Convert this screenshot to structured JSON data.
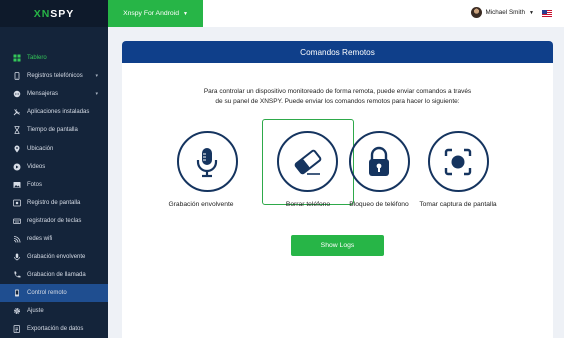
{
  "brand": {
    "prefix": "XN",
    "suffix": "SPY"
  },
  "device_selector": {
    "label": "Xnspy For Android"
  },
  "user": {
    "name": "Michael Smith"
  },
  "sidebar": {
    "items": [
      {
        "label": "Tablero",
        "icon": "dashboard-icon"
      },
      {
        "label": "Registros telefónicos",
        "icon": "phone-icon",
        "has_submenu": true
      },
      {
        "label": "Mensajeras",
        "icon": "message-icon",
        "has_submenu": true
      },
      {
        "label": "Aplicaciones instaladas",
        "icon": "apps-icon"
      },
      {
        "label": "Tiempo de pantalla",
        "icon": "hourglass-icon"
      },
      {
        "label": "Ubicación",
        "icon": "location-icon"
      },
      {
        "label": "Videos",
        "icon": "video-icon"
      },
      {
        "label": "Fotos",
        "icon": "photo-icon"
      },
      {
        "label": "Registro de pantalla",
        "icon": "screen-record-icon"
      },
      {
        "label": "registrador de teclas",
        "icon": "keyboard-icon"
      },
      {
        "label": "redes wifi",
        "icon": "wifi-icon"
      },
      {
        "label": "Grabación envolvente",
        "icon": "microphone-icon"
      },
      {
        "label": "Grabacion de llamada",
        "icon": "call-record-icon"
      },
      {
        "label": "Control remoto",
        "icon": "remote-control-icon"
      },
      {
        "label": "Ajuste",
        "icon": "gear-icon"
      },
      {
        "label": "Exportación de datos",
        "icon": "export-icon"
      }
    ],
    "active_index": 13
  },
  "main": {
    "title": "Comandos Remotos",
    "intro_line1": "Para controlar un dispositivo monitoreado de forma remota, puede enviar comandos a través",
    "intro_line2": "de su panel de XNSPY. Puede enviar los comandos remotos para hacer lo siguiente:",
    "commands": [
      {
        "label": "Grabación envolvente",
        "icon": "microphone-icon"
      },
      {
        "label": "Borrar teléfono",
        "icon": "eraser-icon",
        "selected": true
      },
      {
        "label": "Bloqueo de teléfono",
        "icon": "lock-icon"
      },
      {
        "label": "Tomar captura de pantalla",
        "icon": "screenshot-icon"
      }
    ],
    "show_logs_label": "Show Logs"
  },
  "colors": {
    "sidebar_bg": "#14243a",
    "accent_green": "#27b547",
    "header_blue": "#0f3f8a",
    "active_item": "#1f4e90",
    "icon_navy": "#15345f"
  }
}
